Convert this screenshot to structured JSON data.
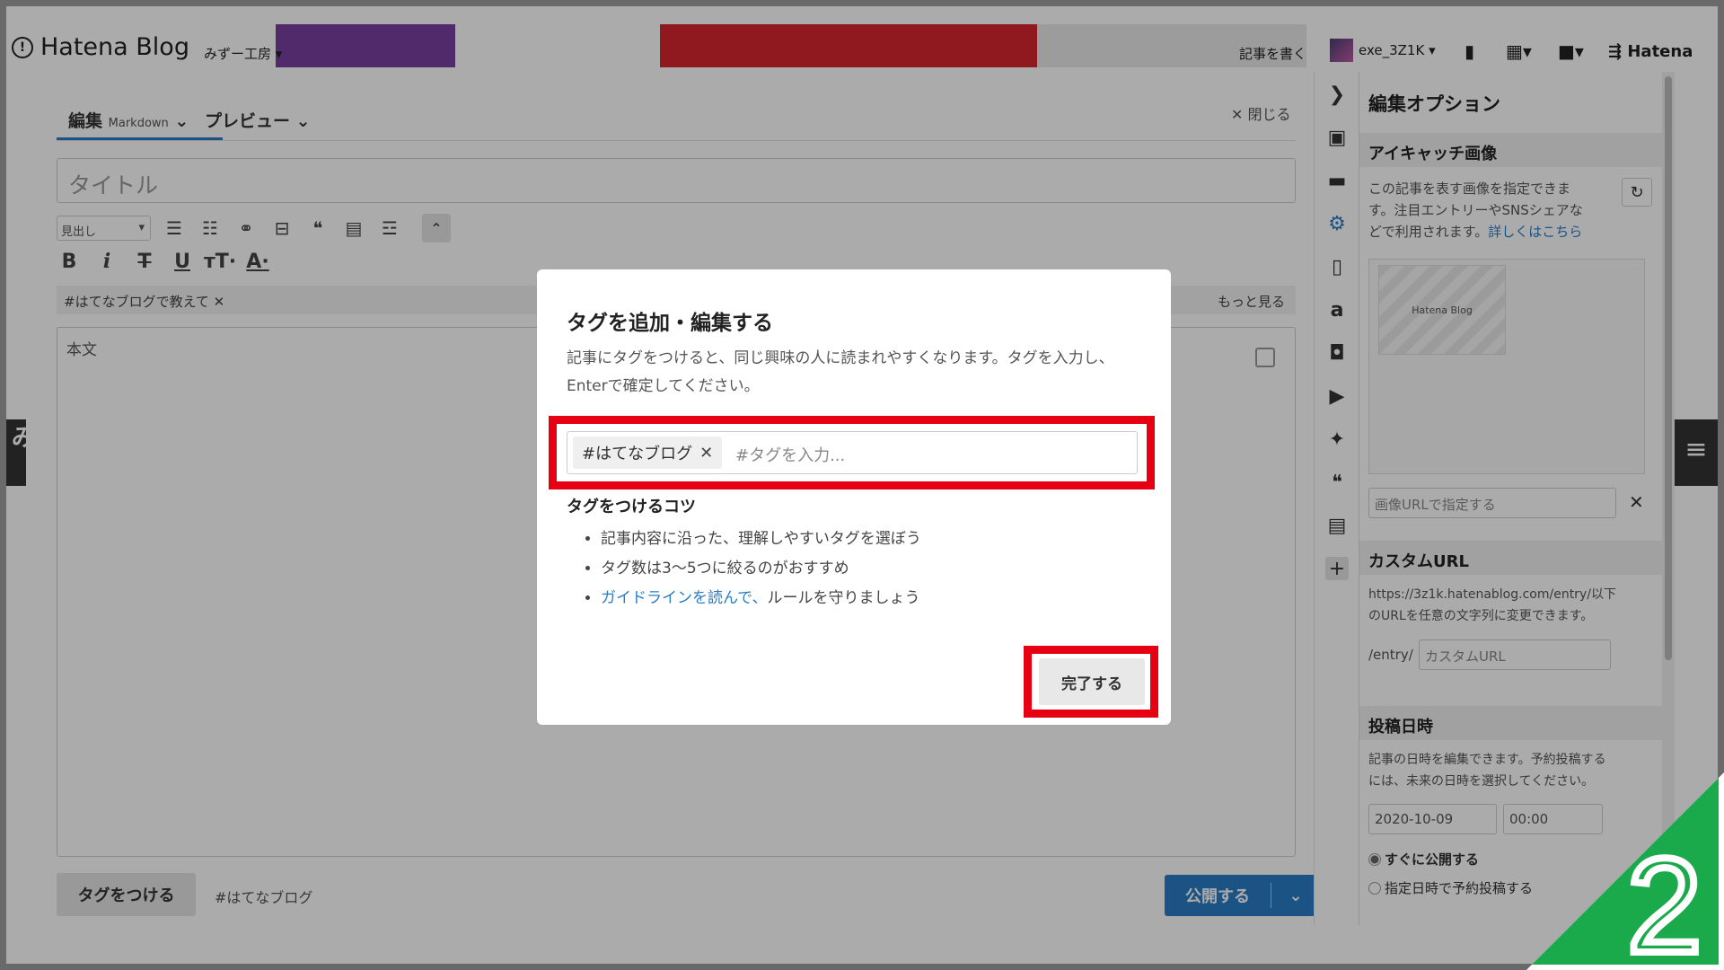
{
  "site": {
    "logo_text": "Hatena Blog",
    "blog_name": "みずー工房",
    "write_link": "記事を書く",
    "user_name": "exe_3Z1K",
    "hatena_brand": "Hatena"
  },
  "editor": {
    "tab_edit": "編集",
    "tab_edit_mode": "Markdown",
    "tab_preview": "プレビュー",
    "close_label": "閉じる",
    "title_placeholder": "タイトル",
    "heading_select": "見出し",
    "suggest_tag": "#はてなブログで教えて",
    "more_label": "もっと見る",
    "body_placeholder": "本文",
    "tag_button": "タグをつける",
    "current_tag": "#はてなブログ",
    "publish_button": "公開する"
  },
  "options": {
    "panel_title": "編集オプション",
    "eyecatch_title": "アイキャッチ画像",
    "eyecatch_desc_1": "この記事を表す画像を指定できま",
    "eyecatch_desc_2": "す。注目エントリーやSNSシェアな",
    "eyecatch_desc_3": "どで利用されます。",
    "eyecatch_link": "詳しくはこちら",
    "thumb_label": "Hatena Blog",
    "image_url_placeholder": "画像URLで指定する",
    "custom_url_title": "カスタムURL",
    "custom_url_desc_1": "https://3z1k.hatenablog.com/entry/以下",
    "custom_url_desc_2": "のURLを任意の文字列に変更できます。",
    "custom_url_prefix": "/entry/",
    "custom_url_placeholder": "カスタムURL",
    "post_date_title": "投稿日時",
    "post_date_desc_1": "記事の日時を編集できます。予約投稿する",
    "post_date_desc_2": "には、未来の日時を選択してください。",
    "date_value": "2020-10-09",
    "time_value": "00:00",
    "radio_now": "すぐに公開する",
    "radio_schedule": "指定日時で予約投稿する"
  },
  "modal": {
    "title": "タグを追加・編集する",
    "desc": "記事にタグをつけると、同じ興味の人に読まれやすくなります。タグを入力し、Enterで確定してください。",
    "tag_chip": "#はてなブログ",
    "tag_input_placeholder": "#タグを入力...",
    "tips_title": "タグをつけるコツ",
    "tip_1": "記事内容に沿った、理解しやすいタグを選ぼう",
    "tip_2": "タグ数は3〜5つに絞るのがおすすめ",
    "tip_3_link": "ガイドラインを読んで、",
    "tip_3_rest": "ルールを守りましょう",
    "done_button": "完了する"
  },
  "badge": {
    "step_number": "2",
    "color": "#1aaa4b"
  },
  "colors": {
    "accent": "#2a7dc6",
    "highlight": "#e60012"
  }
}
